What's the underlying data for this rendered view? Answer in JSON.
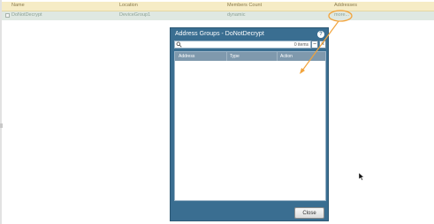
{
  "grid": {
    "columns": [
      "Name",
      "Location",
      "Members Count",
      "Addresses"
    ],
    "row": {
      "name": "DoNotDecrypt",
      "location": "DeviceGroup1",
      "members_count": "dynamic",
      "addresses": "more..."
    }
  },
  "dialog": {
    "title": "Address Groups - DoNotDecrypt",
    "items_count": "0 items",
    "columns": [
      "Address",
      "Type",
      "Action"
    ],
    "close_label": "Close"
  },
  "colors": {
    "highlight": "#f2a33a",
    "dialog_bg": "#3a6e91"
  }
}
